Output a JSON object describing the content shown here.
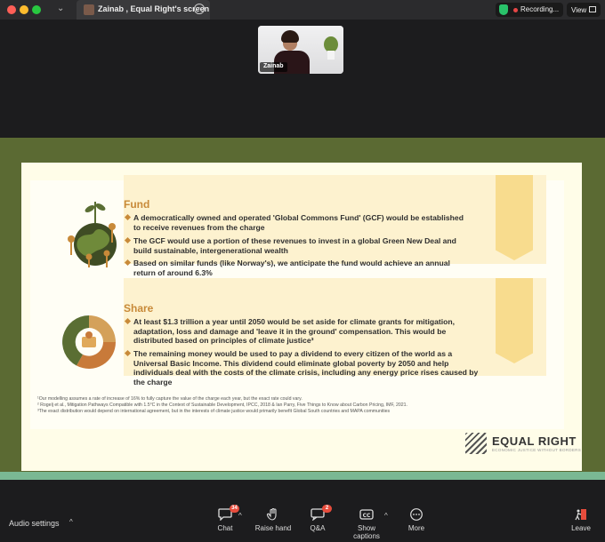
{
  "window": {
    "tab_title": "Zainab , Equal Right's screen",
    "recording_label": "Recording...",
    "view_label": "View"
  },
  "video": {
    "participant_name": "Zainab"
  },
  "slide": {
    "fund": {
      "heading": "Fund",
      "bullets": [
        "A democratically owned and operated 'Global Commons Fund' (GCF) would be established to receive revenues from the charge",
        "The GCF would use a portion of these revenues to invest in a global Green New Deal and build sustainable, intergenerational wealth",
        "Based on similar funds (like Norway's), we anticipate the fund would achieve an annual return of around 6.3%"
      ]
    },
    "share": {
      "heading": "Share",
      "bullets": [
        "At least $1.3 trillion a year until 2050 would be set aside for climate grants for mitigation, adaptation, loss and damage and 'leave it in the ground' compensation. This would be distributed based on principles of climate justice³",
        "The remaining money would be used to pay a dividend to every citizen of the world as a Universal Basic Income. This dividend could eliminate global poverty by 2050 and help individuals deal with the costs of the climate crisis, including any energy price rises caused by the charge"
      ]
    },
    "footnotes": [
      "¹Our modelling assumes a rate of increase of 16% to fully capture the value of the charge each year, but the exact rate could vary.",
      "² Rogelj et al., Mitigation Pathways Compatible with 1.5°C in the Context of Sustainable Development, IPCC, 2018 & Ian Parry, Five Things to Know about Carbon Pricing, IMF, 2021.",
      "³The exact distribution would depend on international agreement, but in the interests of climate justice would primarily benefit Global South countries and MAPA communities"
    ],
    "logo_title": "EQUAL RIGHT",
    "logo_subtitle": "ECONOMIC JUSTICE WITHOUT BORDERS"
  },
  "toolbar": {
    "audio_settings": "Audio settings",
    "chat": {
      "label": "Chat",
      "badge": "34"
    },
    "raise_hand": "Raise hand",
    "qa": {
      "label": "Q&A",
      "badge": "2"
    },
    "captions": "Show captions",
    "more": "More",
    "leave": "Leave"
  },
  "colors": {
    "accent": "#c88a39",
    "slide_band": "#5b6a33",
    "leave": "#e74c3c"
  }
}
